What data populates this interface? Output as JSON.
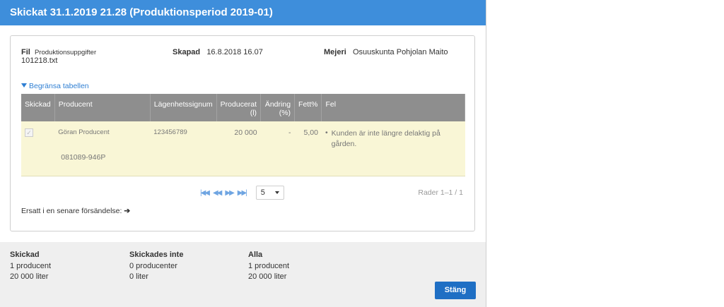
{
  "dialog": {
    "title": "Skickat 31.1.2019 21.28 (Produktionsperiod 2019-01)"
  },
  "info": {
    "fil_label": "Fil",
    "fil_name": "Produktionsuppgifter",
    "fil_name2": "101218.txt",
    "skapad_label": "Skapad",
    "skapad_value": "16.8.2018 16.07",
    "mejeri_label": "Mejeri",
    "mejeri_value": "Osuuskunta Pohjolan Maito"
  },
  "filter_label": "Begränsa tabellen",
  "table": {
    "headers": [
      "Skickad",
      "Producent",
      "Lägenhetssignum",
      "Producerat (l)",
      "Ändring (%)",
      "Fett%",
      "Fel"
    ],
    "rows": [
      {
        "producent": "Göran Producent",
        "producent_id": "081089-946P",
        "signum": "123456789",
        "producerat": "20 000",
        "andring": "-",
        "fett": "5,00",
        "fel": "Kunden är inte längre delaktig på gården."
      }
    ]
  },
  "pager": {
    "page_size": "5",
    "rows_text": "Rader 1–1 / 1"
  },
  "ersatt_text": "Ersatt i en senare försändelse:",
  "summary": {
    "skickad": {
      "title": "Skickad",
      "count": "1 producent",
      "liters": "20 000 liter"
    },
    "skickades_inte": {
      "title": "Skickades inte",
      "count": "0 producenter",
      "liters": "0 liter"
    },
    "alla": {
      "title": "Alla",
      "count": "1 producent",
      "liters": "20 000 liter"
    }
  },
  "close_label": "Stäng",
  "colors": {
    "header": "#3e8edb",
    "button": "#1f6fc4",
    "row_bg": "#f9f6d6",
    "table_header": "#8e8e8e"
  }
}
